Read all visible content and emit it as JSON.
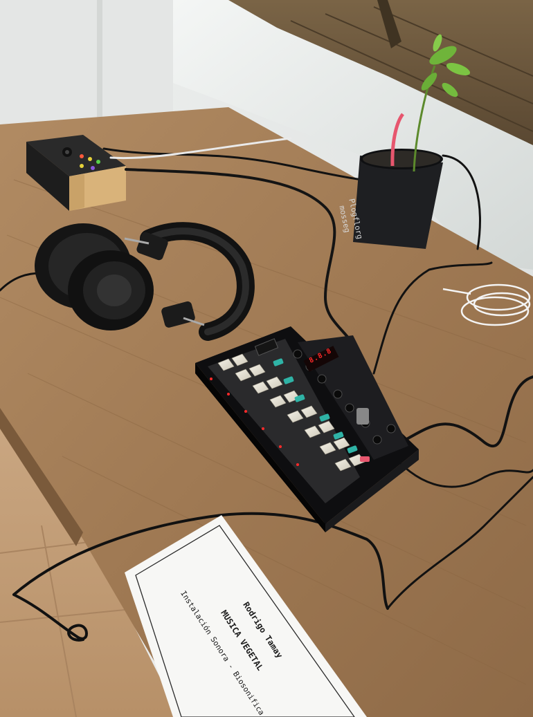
{
  "photo": {
    "card": {
      "artist_name": "Rodrigo Tamay",
      "work_title": "MUSICA VEGETAL",
      "subtitle": "Instalación Sonora - Biosonifica"
    },
    "pot": {
      "label_line_1": "Plogflorg",
      "label_line_2": "mosseg"
    },
    "synth_display": "8.8.8"
  },
  "colors": {
    "table_wood": "#a17b55",
    "floor_tile": "#c9a57e",
    "wall": "#e9ebea",
    "synth_body": "#1c1c1e",
    "synth_pad": "#e6e2d6",
    "synth_knob_teal": "#2fb3a6",
    "plant_leaf": "#6fb43a",
    "probe_pink": "#e7566e",
    "card_paper": "#f7f7f5"
  },
  "icons": {
    "headphones": "headphones-icon",
    "synthesizer": "synthesizer-icon",
    "plant_pot": "plant-pot-icon",
    "sensor_box": "sensor-box-icon"
  }
}
